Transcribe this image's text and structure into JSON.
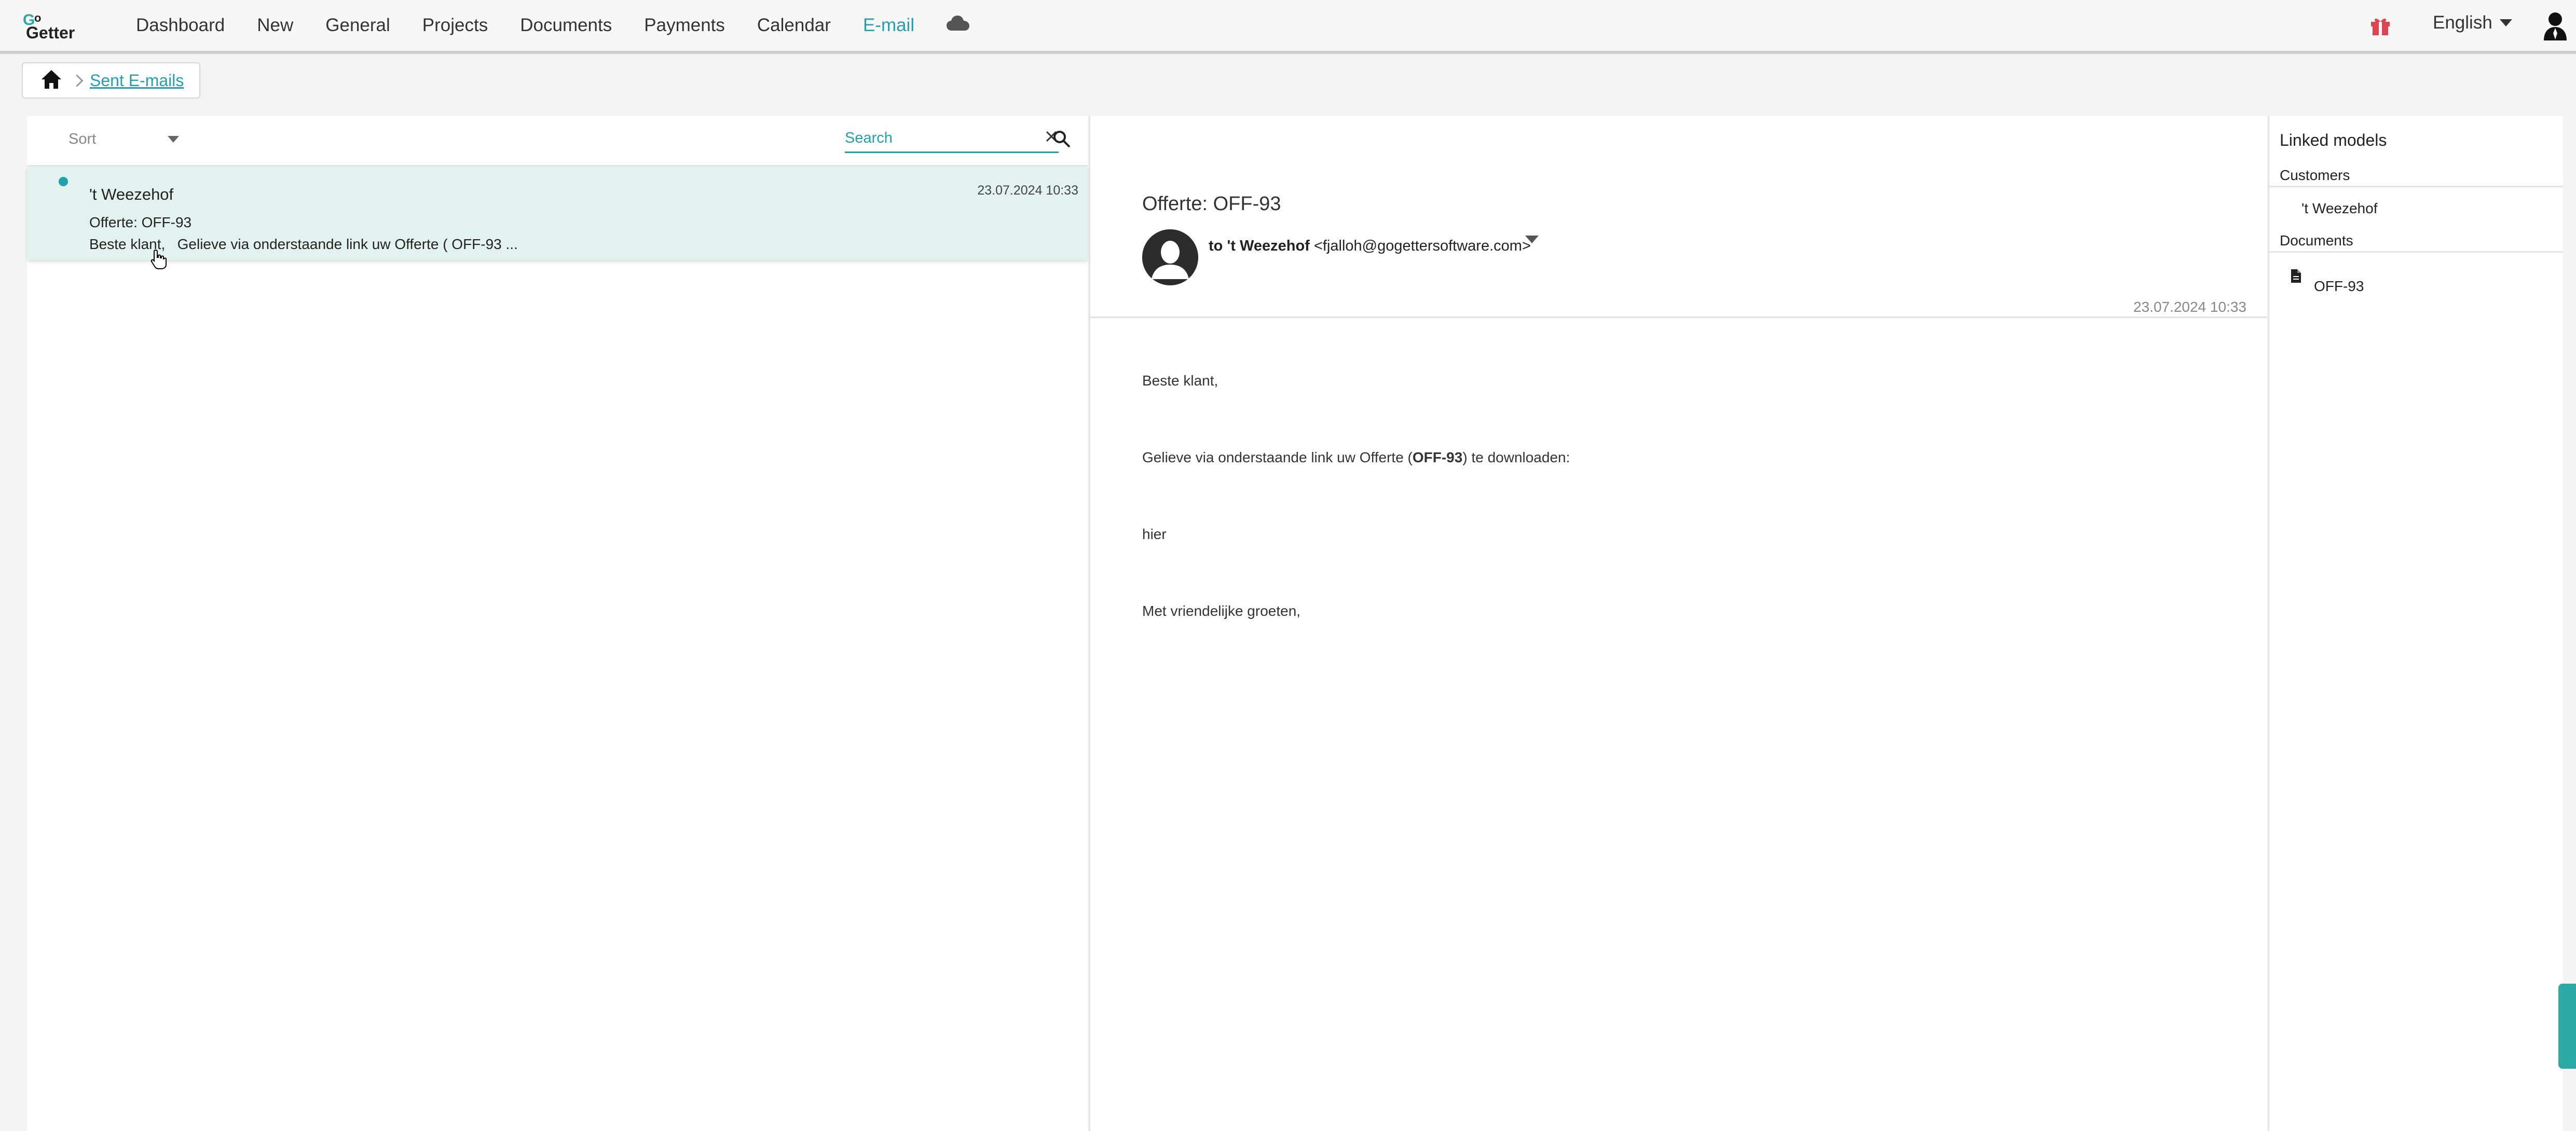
{
  "nav": {
    "logo_alt": "GoGetter",
    "items": [
      "Dashboard",
      "New",
      "General",
      "Projects",
      "Documents",
      "Payments",
      "Calendar",
      "E-mail"
    ],
    "active": "E-mail",
    "cloud_icon": "cloud-icon",
    "language": "English"
  },
  "breadcrumb": {
    "home_icon": "home-icon",
    "current": "Sent E-mails"
  },
  "list": {
    "sort_label": "Sort",
    "search_placeholder": "Search",
    "rows": [
      {
        "from": "'t Weezehof",
        "date": "23.07.2024 10:33",
        "subject": "Offerte: OFF-93",
        "preview": "Beste klant,   Gelieve via onderstaande link uw Offerte ( OFF-93 ...",
        "unread": true
      }
    ]
  },
  "detail": {
    "title": "Offerte: OFF-93",
    "to_prefix": "to",
    "to_name": "'t Weezehof",
    "to_email": "<fjalloh@gogettersoftware.com>",
    "date": "23.07.2024 10:33",
    "body": {
      "greeting": "Beste klant,",
      "line2_pre": "Gelieve via onderstaande link uw Offerte (",
      "line2_code": "OFF-93",
      "line2_post": ") te downloaden:",
      "link_text": "hier",
      "closing": "Met vriendelijke groeten,"
    }
  },
  "linked": {
    "title": "Linked models",
    "customers_label": "Customers",
    "customers": [
      "'t Weezehof"
    ],
    "documents_label": "Documents",
    "documents": [
      "OFF-93"
    ]
  },
  "colors": {
    "accent": "#21a0b0",
    "row_selected": "#e1f2ef",
    "gift": "#e0434f"
  }
}
